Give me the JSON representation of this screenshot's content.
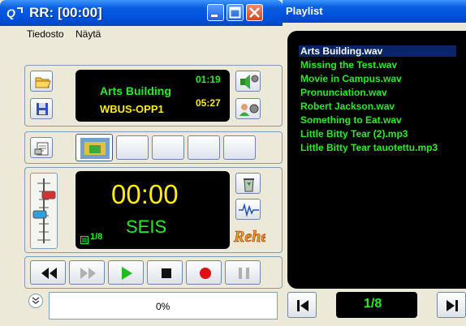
{
  "main_window": {
    "title": "RR: [00:00]",
    "menu": [
      "Tiedosto",
      "Näytä"
    ]
  },
  "info_display": {
    "track_name": "Arts Building",
    "elapsed": "01:19",
    "station": "WBUS-OPP1",
    "duration": "05:27"
  },
  "main_display": {
    "time": "00:00",
    "status": "SEIS",
    "track_position": "1/8"
  },
  "progress": {
    "label": "0%",
    "value": 0
  },
  "playlist": {
    "title": "Playlist",
    "items": [
      "Arts Building.wav",
      "Missing the Test.wav",
      "Movie in Campus.wav",
      "Pronunciation.wav",
      "Robert Jackson.wav",
      "Something to Eat.wav",
      "Little Bitty Tear (2).mp3",
      "Little Bitty Tear tauotettu.mp3"
    ],
    "selected_index": 0,
    "position": "1/8"
  },
  "colors": {
    "lcd_green": "#22ee22",
    "lcd_yellow": "#ffee00",
    "title_blue": "#0050dc"
  }
}
